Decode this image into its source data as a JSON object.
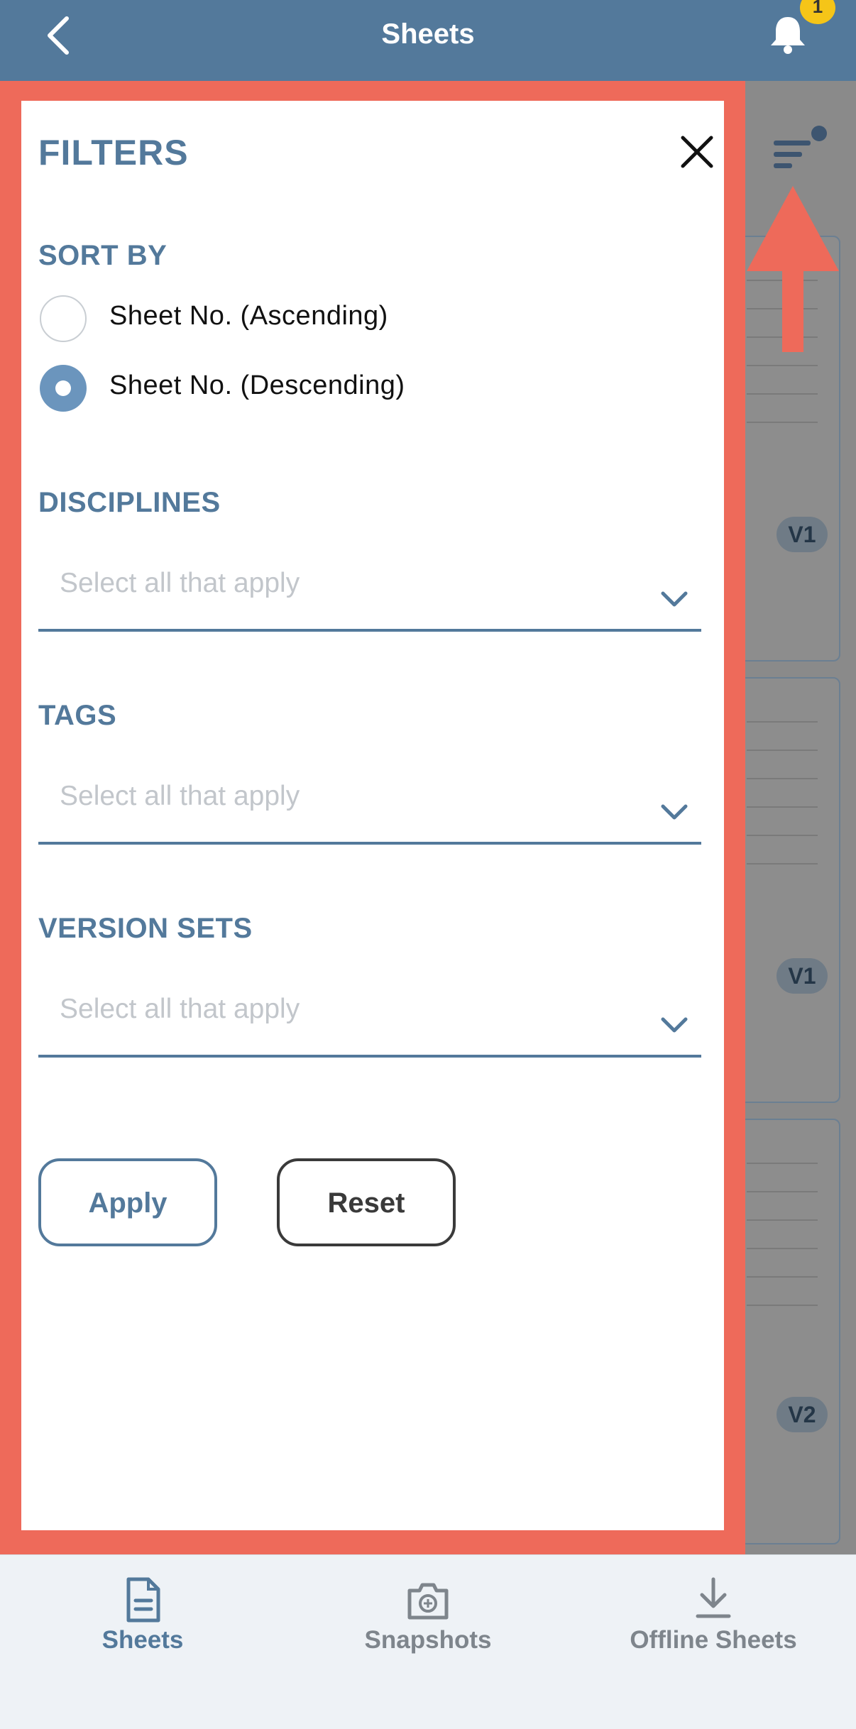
{
  "header": {
    "title": "Sheets",
    "notification_count": "1"
  },
  "background_cards": [
    {
      "version": "V1"
    },
    {
      "version": "V1"
    },
    {
      "version": "V2"
    }
  ],
  "filters": {
    "title": "FILTERS",
    "sort_by": {
      "label": "SORT BY",
      "options": [
        {
          "label": "Sheet No. (Ascending)",
          "selected": false
        },
        {
          "label": "Sheet No. (Descending)",
          "selected": true
        }
      ]
    },
    "disciplines": {
      "label": "DISCIPLINES",
      "placeholder": "Select all that apply"
    },
    "tags": {
      "label": "TAGS",
      "placeholder": "Select all that apply"
    },
    "version_sets": {
      "label": "VERSION SETS",
      "placeholder": "Select all that apply"
    },
    "apply_label": "Apply",
    "reset_label": "Reset"
  },
  "bottom_nav": {
    "items": [
      {
        "label": "Sheets",
        "icon": "document-icon",
        "active": true
      },
      {
        "label": "Snapshots",
        "icon": "camera-icon",
        "active": false
      },
      {
        "label": "Offline Sheets",
        "icon": "download-icon",
        "active": false
      }
    ]
  },
  "colors": {
    "primary": "#53799b",
    "highlight": "#ee6a5a",
    "badge": "#f5c518",
    "radio_selected": "#6b95bd"
  }
}
